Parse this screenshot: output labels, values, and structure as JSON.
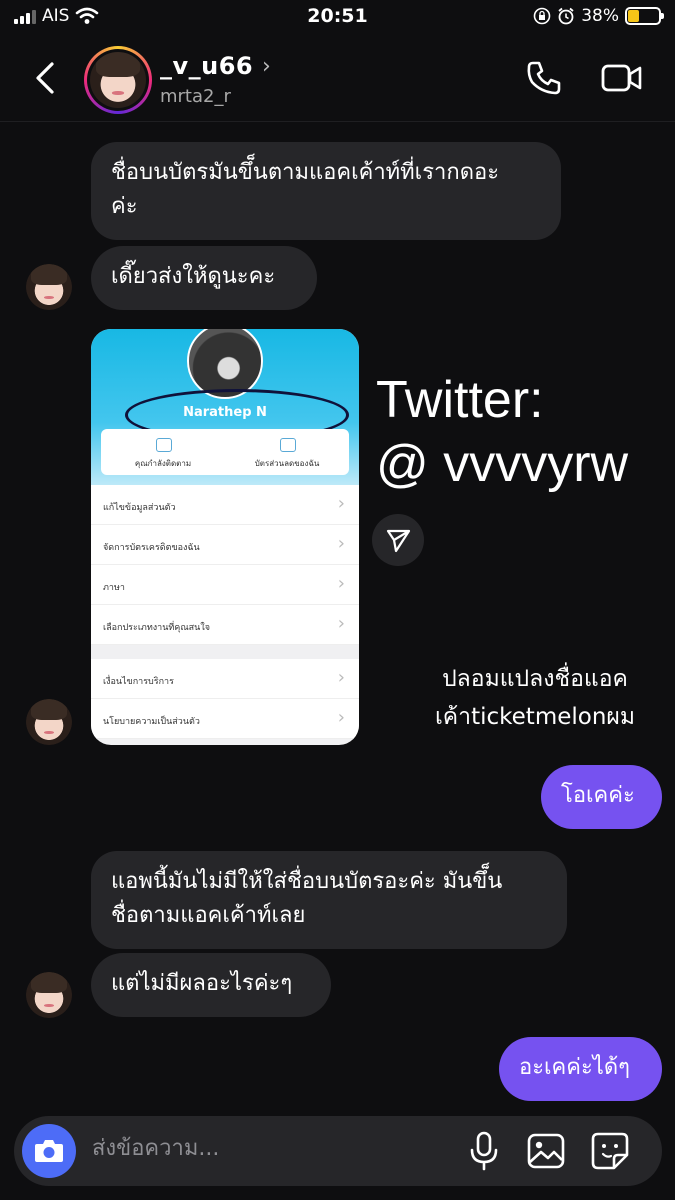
{
  "status_bar": {
    "carrier": "AIS",
    "time": "20:51",
    "battery_percent": "38%",
    "battery_level": 0.38
  },
  "header": {
    "username": "_v_u66",
    "handle": "mrta2_r",
    "back_icon": "chevron-left-icon",
    "call_icon": "phone-icon",
    "video_icon": "video-camera-icon"
  },
  "messages": [
    {
      "side": "in",
      "text": "ชื่อบนบัตรมันขึ็นตามแอคเค้าท์ที่เรากดอะ\nค่ะ"
    },
    {
      "side": "in",
      "text": "เดี๊ยวส่งให้ดูนะคะ"
    },
    {
      "side": "in",
      "type": "image"
    },
    {
      "side": "out",
      "text": "โอเคค่ะ"
    },
    {
      "side": "in",
      "text": "แอพนี้มันไม่มีให้ใส่ชื่อบนบัตรอะค่ะ มันขึ็น\nชื่อตามแอคเค้าท์เลย"
    },
    {
      "side": "in",
      "text": "แต่ไม่มีผลอะไรค่ะๆ"
    },
    {
      "side": "out",
      "text": "อะเคค่ะได้ๆ"
    }
  ],
  "shared_image": {
    "profile_name": "Narathep N",
    "card_left": "คุณกำลังติดตาม",
    "card_right": "บัตรส่วนลดของฉัน",
    "menu_items": [
      "แก้ไขข้อมูลส่วนตัว",
      "จัดการบัตรเครดิตของฉัน",
      "ภาษา",
      "เลือกประเภทงานที่คุณสนใจ",
      "เงื่อนไขการบริการ",
      "นโยบายความเป็นส่วนตัว"
    ]
  },
  "overlay": {
    "twitter_line1": "Twitter:",
    "twitter_line2": "@ vvvvyrw",
    "caption_line1": "ปลอมแปลงชื่อแอค",
    "caption_line2": "เค้าticketmelonผม"
  },
  "composer": {
    "placeholder": "ส่งข้อความ...",
    "camera_icon": "camera-icon",
    "mic_icon": "microphone-icon",
    "gallery_icon": "image-gallery-icon",
    "sticker_icon": "sticker-icon"
  },
  "colors": {
    "background": "#0e0e10",
    "incoming_bubble": "#262629",
    "outgoing_bubble": "#7652f0",
    "camera_button": "#4d6cf7"
  }
}
